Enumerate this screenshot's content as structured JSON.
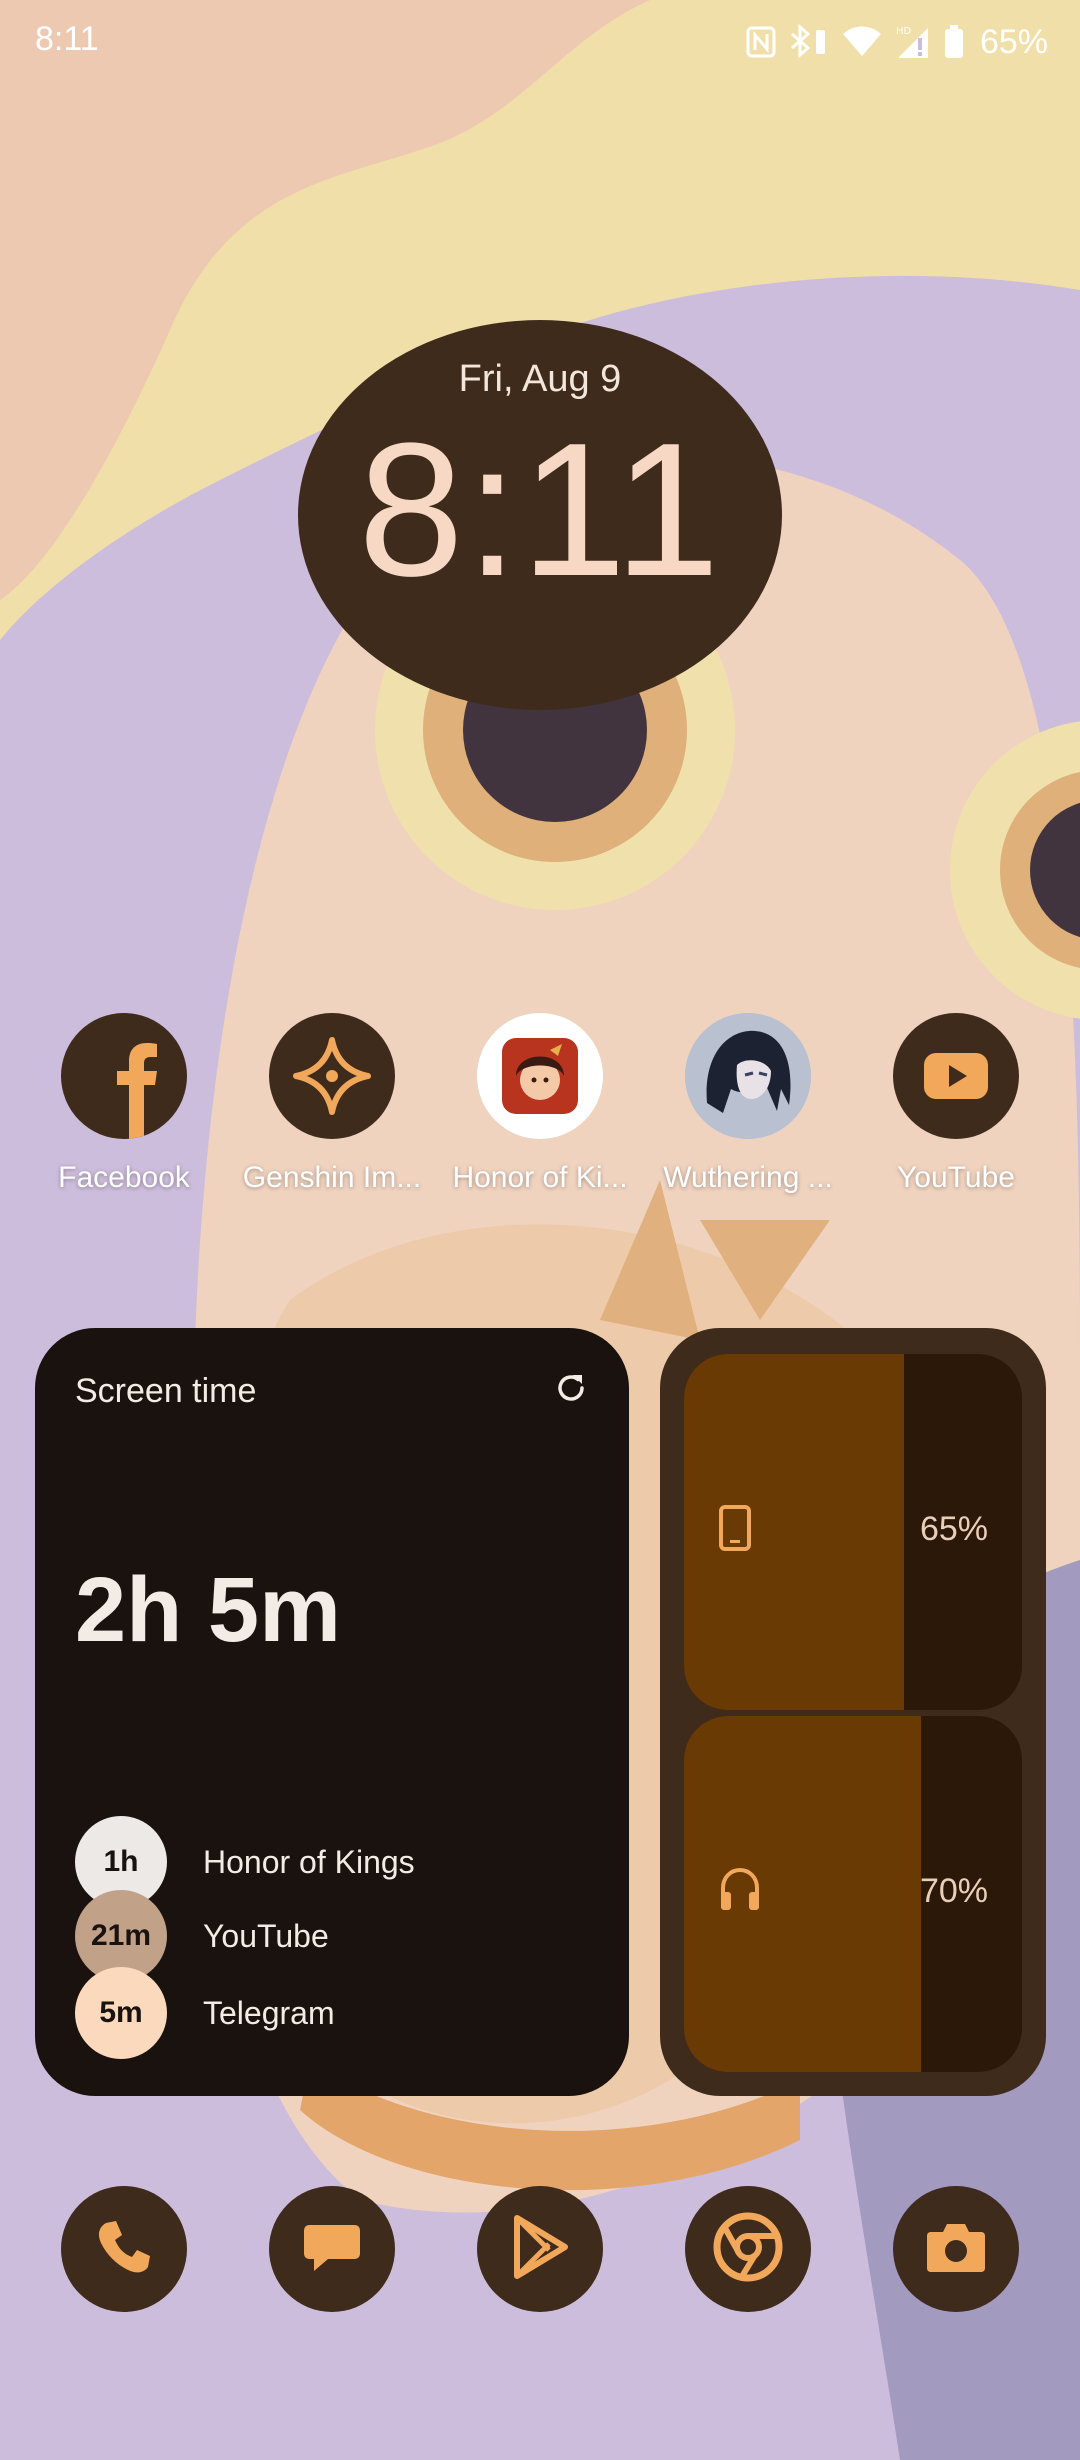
{
  "status_bar": {
    "time": "8:11",
    "battery_percent": "65%",
    "icons": [
      "nfc-icon",
      "bluetooth-battery-icon",
      "wifi-icon",
      "hd-signal-icon",
      "battery-icon"
    ]
  },
  "clock": {
    "date": "Fri, Aug 9",
    "time": "8:11"
  },
  "apps": [
    {
      "label": "Facebook",
      "icon": "facebook-icon"
    },
    {
      "label": "Genshin Im...",
      "icon": "genshin-impact-icon"
    },
    {
      "label": "Honor of Ki...",
      "icon": "honor-of-kings-icon"
    },
    {
      "label": "Wuthering ...",
      "icon": "wuthering-waves-icon"
    },
    {
      "label": "YouTube",
      "icon": "youtube-icon"
    }
  ],
  "screen_time": {
    "title": "Screen time",
    "total": "2h 5m",
    "entries": [
      {
        "duration": "1h",
        "app": "Honor of Kings",
        "color": "#ece9e6"
      },
      {
        "duration": "21m",
        "app": "YouTube",
        "color": "#c2a189"
      },
      {
        "duration": "5m",
        "app": "Telegram",
        "color": "#fbd9bd"
      }
    ]
  },
  "battery_widget": {
    "devices": [
      {
        "device": "phone-icon",
        "percent_label": "65%",
        "level": 0.65
      },
      {
        "device": "headphones-icon",
        "percent_label": "70%",
        "level": 0.7
      }
    ]
  },
  "dock": [
    "phone-icon",
    "messages-icon",
    "play-store-icon",
    "chrome-icon",
    "camera-icon"
  ],
  "colors": {
    "accent_dark": "#3e2b1c",
    "accent_orange": "#f2a85a",
    "widget_bg": "#1a120e",
    "battery_fill": "#6a3a05"
  }
}
